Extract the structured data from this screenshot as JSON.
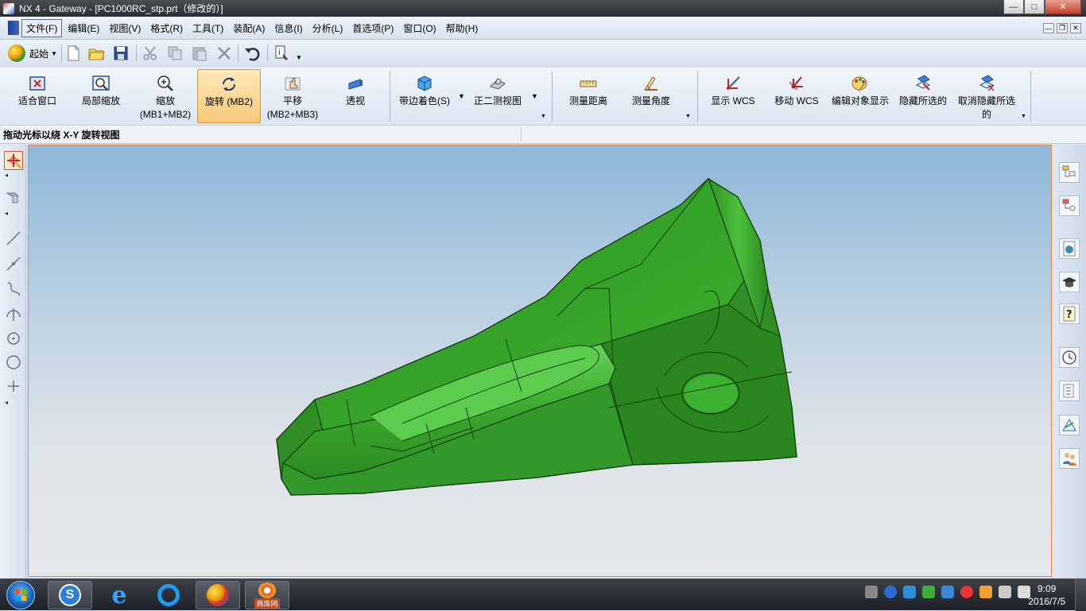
{
  "window": {
    "title": "NX 4 - Gateway - [PC1000RC_stp.prt（修改的）]",
    "buttons": {
      "minimize": "—",
      "maximize": "□",
      "close": "✕"
    }
  },
  "menu": {
    "items": [
      "文件(F)",
      "编辑(E)",
      "视图(V)",
      "格式(R)",
      "工具(T)",
      "装配(A)",
      "信息(I)",
      "分析(L)",
      "首选项(P)",
      "窗口(O)",
      "帮助(H)"
    ],
    "active_index": 0,
    "mdi": {
      "min": "—",
      "restore": "❐",
      "close": "✕"
    }
  },
  "toolbar": {
    "start_label": "起始",
    "tools": [
      "new-file-icon",
      "open-folder-icon",
      "save-icon",
      "cut-icon",
      "copy-icon",
      "paste-icon",
      "delete-icon",
      "undo-icon",
      "info-icon"
    ]
  },
  "ribbon": {
    "buttons": [
      {
        "label": "适合窗口",
        "icon": "fit-window-icon"
      },
      {
        "label": "局部缩放",
        "icon": "zoom-region-icon"
      },
      {
        "label": "缩放",
        "label2": "(MB1+MB2)",
        "icon": "zoom-icon"
      },
      {
        "label": "旋转 (MB2)",
        "icon": "rotate-icon",
        "active": true
      },
      {
        "label": "平移",
        "label2": "(MB2+MB3)",
        "icon": "pan-icon"
      },
      {
        "label": "透视",
        "icon": "perspective-icon"
      },
      {
        "label": "带边着色(S)",
        "icon": "shaded-with-edges-icon"
      },
      {
        "label": "正二测视图",
        "icon": "trimetric-view-icon"
      },
      {
        "label": "测量距离",
        "icon": "measure-distance-icon"
      },
      {
        "label": "测量角度",
        "icon": "measure-angle-icon"
      },
      {
        "label": "显示 WCS",
        "icon": "show-wcs-icon"
      },
      {
        "label": "移动 WCS",
        "icon": "move-wcs-icon"
      },
      {
        "label": "编辑对象显示",
        "icon": "edit-object-display-icon"
      },
      {
        "label": "隐藏所选的",
        "icon": "hide-selected-icon"
      },
      {
        "label": "取消隐藏所选",
        "label2": "的",
        "icon": "unhide-selected-icon"
      }
    ]
  },
  "hint": {
    "text": "拖动光标以绕 X-Y 旋转视图"
  },
  "left_tools": [
    "rotate-xy-icon",
    "snap-view-icon",
    "line-icon",
    "line-point-icon",
    "curve-icon",
    "tangent-icon",
    "point-on-circle-icon",
    "circle-icon",
    "point-icon"
  ],
  "right_tools": [
    "assembly-navigator-icon",
    "part-navigator-icon",
    "web-browser-icon",
    "training-icon",
    "help-icon",
    "history-icon",
    "system-materials-icon",
    "process-studio-icon",
    "roles-icon"
  ],
  "viewport": {
    "model_color": "#3aa82c",
    "edge_color": "#1b4a14"
  },
  "taskbar": {
    "apps": [
      "start-orb-icon",
      "sogou-icon",
      "internet-explorer-icon",
      "qq-browser-icon",
      "nx-icon",
      "shangku-icon"
    ],
    "shangku_label": "商库网",
    "time": "9:09",
    "date": "2016/7/5"
  }
}
